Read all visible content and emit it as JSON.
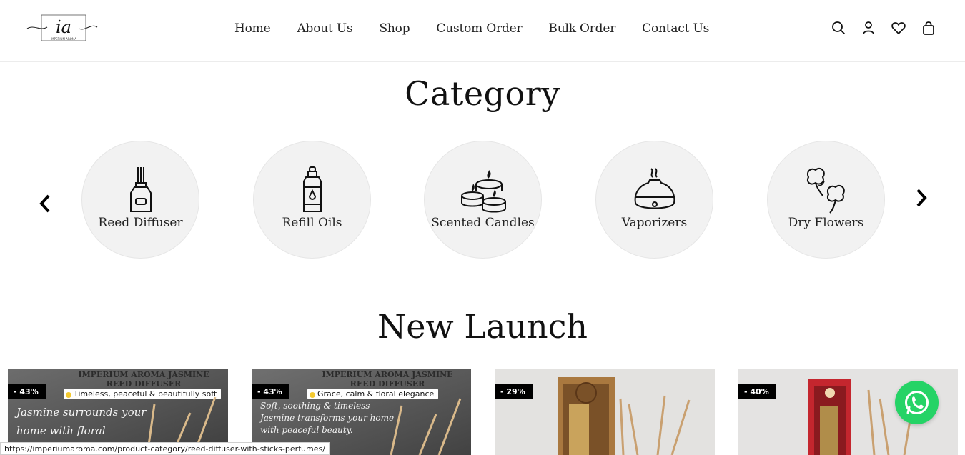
{
  "brand": {
    "logo_text": "ia",
    "logo_subtext": "IMPERIUM AROMA"
  },
  "nav": {
    "items": [
      {
        "label": "Home"
      },
      {
        "label": "About Us"
      },
      {
        "label": "Shop"
      },
      {
        "label": "Custom Order"
      },
      {
        "label": "Bulk Order"
      },
      {
        "label": "Contact Us"
      }
    ]
  },
  "header_icons": [
    "search-icon",
    "user-icon",
    "heart-icon",
    "bag-icon"
  ],
  "category": {
    "title": "Category",
    "items": [
      {
        "label": "Reed Diffuser",
        "icon": "reed-diffuser-icon"
      },
      {
        "label": "Refill Oils",
        "icon": "refill-oil-bottle-icon"
      },
      {
        "label": "Scented Candles",
        "icon": "candles-icon"
      },
      {
        "label": "Vaporizers",
        "icon": "vaporizer-icon"
      },
      {
        "label": "Dry Flowers",
        "icon": "dry-flowers-icon"
      }
    ]
  },
  "new_launch": {
    "title": "New Launch",
    "products": [
      {
        "discount": "- 43%",
        "title": "IMPERIUM AROMA JASMINE REED DIFFUSER",
        "tagline": "Timeless, peaceful & beautifully soft",
        "script": "Jasmine surrounds your home with floral serenity."
      },
      {
        "discount": "- 43%",
        "title": "IMPERIUM AROMA JASMINE REED DIFFUSER",
        "tagline": "Grace, calm & floral elegance",
        "script": "Soft, soothing & timeless — Jasmine transforms your home with peaceful beauty."
      },
      {
        "discount": "- 29%"
      },
      {
        "discount": "- 40%"
      }
    ]
  },
  "status_bar": {
    "url": "https://imperiumaroma.com/product-category/reed-diffuser-with-sticks-perfumes/"
  },
  "colors": {
    "accent": "#25d366",
    "badge": "#000000",
    "circle": "#f2f2f2"
  }
}
